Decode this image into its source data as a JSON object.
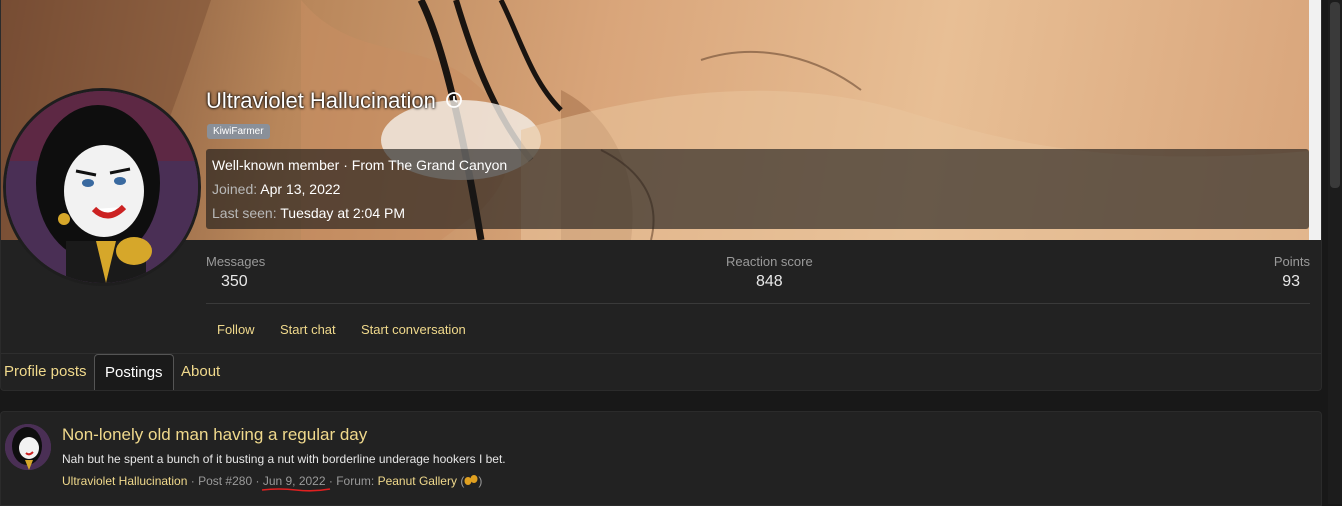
{
  "user": {
    "name": "Ultraviolet Hallucination",
    "badge_icon": "clock-history-icon",
    "role": "KiwiFarmer",
    "title_line": "Well-known member · From The Grand Canyon",
    "joined_label": "Joined:",
    "joined_value": "Apr 13, 2022",
    "last_seen_label": "Last seen:",
    "last_seen_value": "Tuesday at 2:04 PM"
  },
  "stats": {
    "messages_label": "Messages",
    "messages_value": "350",
    "reaction_label": "Reaction score",
    "reaction_value": "848",
    "points_label": "Points",
    "points_value": "93"
  },
  "actions": {
    "follow": "Follow",
    "start_chat": "Start chat",
    "start_conversation": "Start conversation"
  },
  "tabs": [
    {
      "label": "Profile posts",
      "active": false
    },
    {
      "label": "Postings",
      "active": true
    },
    {
      "label": "About",
      "active": false
    }
  ],
  "post": {
    "title": "Non-lonely old man having a regular day",
    "snippet": "Nah but he spent a bunch of it busting a nut with borderline underage hookers I bet.",
    "author": "Ultraviolet Hallucination",
    "sep": "·",
    "post_no": "Post #280",
    "date": "Jun 9, 2022",
    "forum_prefix": "Forum:",
    "forum": "Peanut Gallery",
    "forum_icon": "peanut-icon"
  },
  "colors": {
    "accent_link": "#f0d98c",
    "tab_underline": "#f0a830",
    "annotation_red": "#e02020"
  }
}
